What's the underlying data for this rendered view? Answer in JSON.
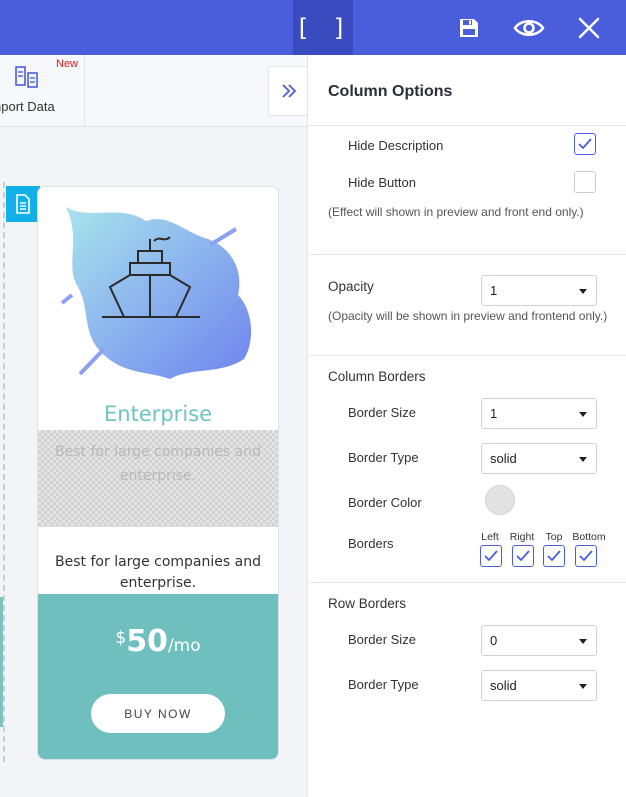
{
  "topbar": {
    "brackets_label": "[ ]",
    "icons": [
      "brackets-icon",
      "save-icon",
      "eye-icon",
      "close-icon"
    ]
  },
  "toolbar": {
    "import_label": "nport Data",
    "import_badge": "New"
  },
  "card": {
    "title": "Enterprise",
    "description": "Best for large companies and enterprise.",
    "price_currency": "$",
    "price_amount": "50",
    "price_period": "/mo",
    "button_label": "BUY NOW",
    "colors": {
      "accent": "#6fbfbe",
      "title": "#6ec4c4"
    }
  },
  "panel": {
    "title": "Column Options",
    "hide_description": {
      "label": "Hide Description",
      "checked": true
    },
    "hide_button": {
      "label": "Hide Button",
      "checked": false
    },
    "effect_note": "(Effect will shown in preview and front end only.)",
    "opacity": {
      "label": "Opacity",
      "value": "1",
      "note": "(Opacity will be shown in preview and frontend only.)"
    },
    "column_borders": {
      "title": "Column Borders",
      "size_label": "Border Size",
      "size_value": "1",
      "type_label": "Border Type",
      "type_value": "solid",
      "color_label": "Border Color",
      "color_value": "#e2e2e2",
      "borders_label": "Borders",
      "sides": [
        {
          "label": "Left",
          "checked": true
        },
        {
          "label": "Right",
          "checked": true
        },
        {
          "label": "Top",
          "checked": true
        },
        {
          "label": "Bottom",
          "checked": true
        }
      ]
    },
    "row_borders": {
      "title": "Row Borders",
      "size_label": "Border Size",
      "size_value": "0",
      "type_label": "Border Type",
      "type_value": "solid"
    }
  },
  "colors": {
    "primary": "#4a5ddb",
    "primary_dark": "#3a4bbf",
    "edit_badge": "#13b0e8",
    "new_badge": "#e01b1b"
  }
}
